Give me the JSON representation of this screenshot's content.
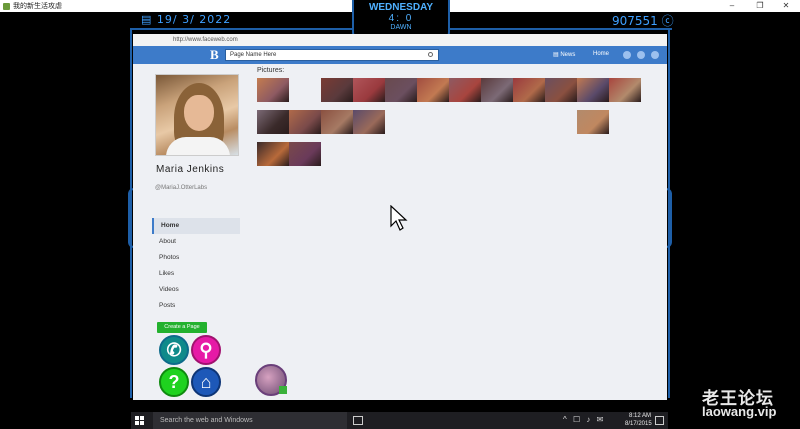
{
  "window": {
    "title": "我的新生活攻虐"
  },
  "hud": {
    "date": "19/ 3/ 2022",
    "day": "WEDNESDAY",
    "time": "4: 0",
    "phase": "DAWN",
    "money": "907551"
  },
  "browser": {
    "url": "http://www.faceweb.com",
    "logo": "B",
    "search_placeholder": "Page Name Here",
    "nav": {
      "news_label": "News",
      "home_label": "Home"
    }
  },
  "profile": {
    "name": "Maria Jenkins",
    "handle": "@MariaJ.OtterLabs",
    "menu": [
      {
        "label": "Home",
        "active": true
      },
      {
        "label": "About",
        "active": false
      },
      {
        "label": "Photos",
        "active": false
      },
      {
        "label": "Likes",
        "active": false
      },
      {
        "label": "Videos",
        "active": false
      },
      {
        "label": "Posts",
        "active": false
      }
    ],
    "create_page_label": "Create a Page"
  },
  "pictures": {
    "label": "Pictures:",
    "thumb_colors": [
      "#c47c4f",
      "#7a3b33",
      "#b0555a",
      "#6a4a4e",
      "#a14d40",
      "#8e5a62",
      "#5a3a3c",
      "#9a3a3e",
      "#6b4f5f",
      "#c27a52",
      "#a8453e",
      "#7c6a76",
      "#b06a4a",
      "#8a5040",
      "#5a4a6a",
      "#b28a6c",
      "#3a2a2a",
      "#7a4a4a",
      "#a67a64",
      "#9a6a5a",
      "#c08860",
      "#b86a3a",
      "#6a3a5a",
      "#4a3a2a"
    ]
  },
  "taskbar": {
    "search_placeholder": "Search the web and Windows",
    "tray_icons": "^ ☐ ♪ ✉",
    "time": "8:12 AM",
    "date": "8/17/2015"
  },
  "watermark": {
    "cn": "老王论坛",
    "en": "laowang.vip"
  },
  "colors": {
    "hud_blue": "#1e5fa8",
    "hud_text": "#3fa0ff",
    "nav_blue": "#3d7bc9",
    "create_green": "#23b12e"
  },
  "icons": [
    "phone-icon",
    "location-pin-icon",
    "question-icon",
    "home-icon",
    "search-icon",
    "cursor-icon"
  ]
}
